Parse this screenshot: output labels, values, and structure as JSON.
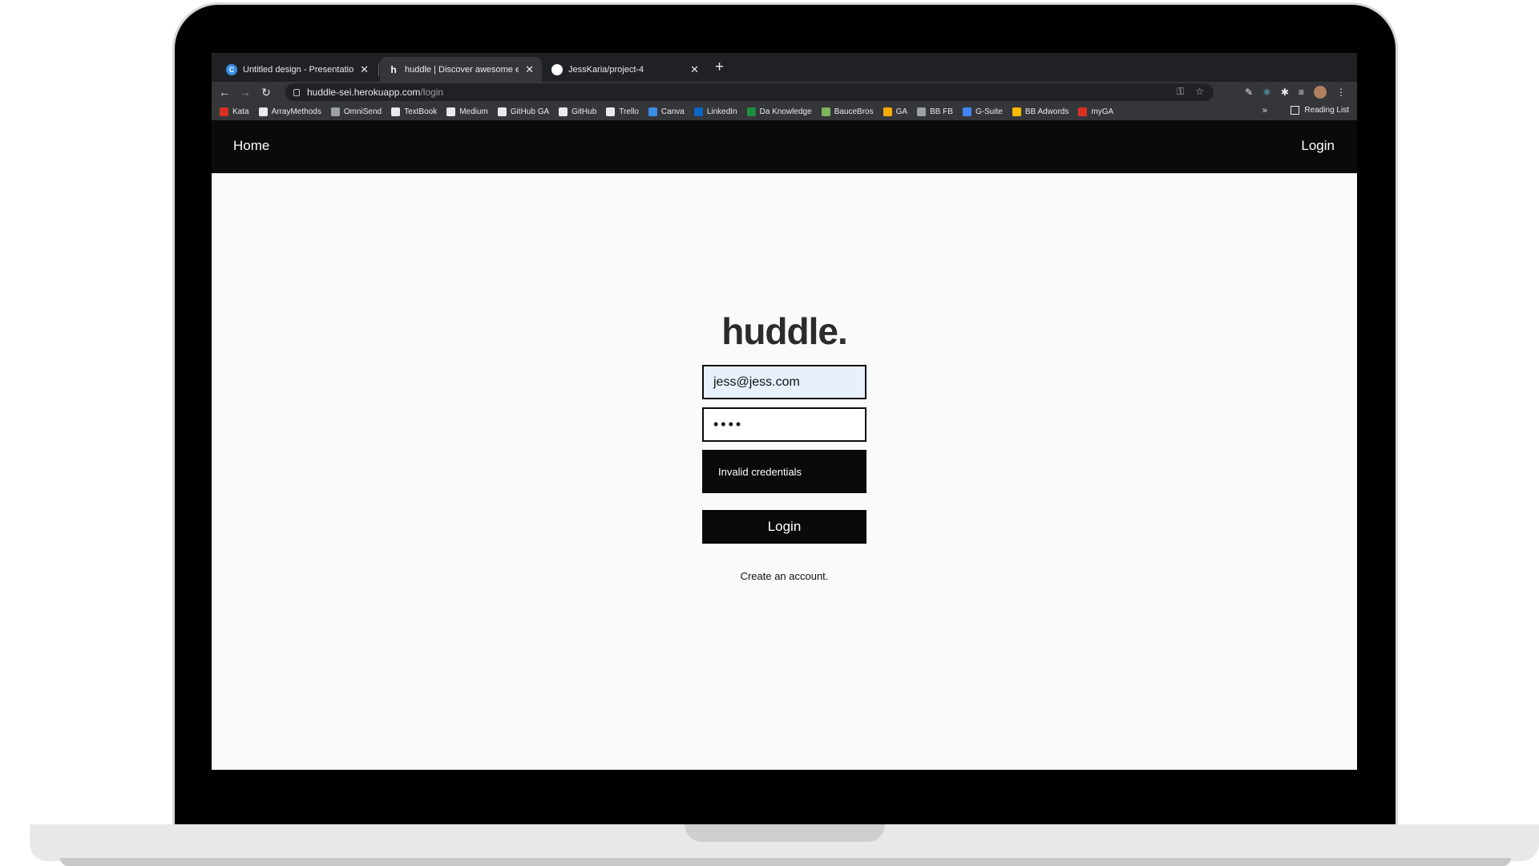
{
  "browser": {
    "tabs": [
      {
        "title": "Untitled design - Presentation",
        "favicon": "canva-icon",
        "favicon_letter": "C",
        "favicon_color": "#3a8ee6"
      },
      {
        "title": "huddle | Discover awesome ev",
        "favicon": "huddle-icon",
        "favicon_letter": "h",
        "favicon_color": "#35363a"
      },
      {
        "title": "JessKaria/project-4",
        "favicon": "github-icon",
        "favicon_letter": "",
        "favicon_color": "#ffffff"
      }
    ],
    "url": {
      "host": "huddle-sei.herokuapp.com",
      "path": "/login"
    },
    "bookmarks": [
      {
        "label": "Kata",
        "color": "#d93025"
      },
      {
        "label": "ArrayMethods",
        "color": "#e8eaed"
      },
      {
        "label": "OmniSend",
        "color": "#9aa0a6"
      },
      {
        "label": "TextBook",
        "color": "#e8eaed"
      },
      {
        "label": "Medium",
        "color": "#e8eaed"
      },
      {
        "label": "GitHub GA",
        "color": "#e8eaed"
      },
      {
        "label": "GitHub",
        "color": "#e8eaed"
      },
      {
        "label": "Trello",
        "color": "#e8eaed"
      },
      {
        "label": "Canva",
        "color": "#3a8ee6"
      },
      {
        "label": "LinkedIn",
        "color": "#0a66c2"
      },
      {
        "label": "Da Knowledge",
        "color": "#1e8e3e"
      },
      {
        "label": "BauceBros",
        "color": "#7ab55c"
      },
      {
        "label": "GA",
        "color": "#f9ab00"
      },
      {
        "label": "BB FB",
        "color": "#9aa0a6"
      },
      {
        "label": "G-Suite",
        "color": "#4285f4"
      },
      {
        "label": "BB Adwords",
        "color": "#fbbc04"
      },
      {
        "label": "myGA",
        "color": "#d93025"
      }
    ],
    "bookmarks_more": "»",
    "reading_list": "Reading List"
  },
  "site": {
    "nav": {
      "home": "Home",
      "login": "Login"
    },
    "logo": "huddle.",
    "email_value": "jess@jess.com",
    "password_value": "••••",
    "error_message": "Invalid credentials",
    "login_button": "Login",
    "create_account": "Create an account."
  }
}
